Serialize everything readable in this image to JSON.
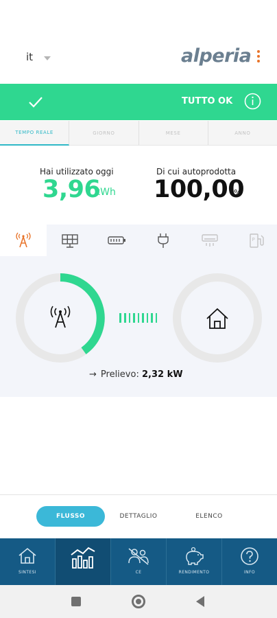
{
  "header": {
    "language": "it",
    "logo_text": "alperia"
  },
  "status": {
    "text": "TUTTO OK",
    "color": "#2fd790"
  },
  "period_tabs": [
    {
      "label": "TEMPO REALE",
      "active": true
    },
    {
      "label": "GIORNO",
      "active": false
    },
    {
      "label": "MESE",
      "active": false
    },
    {
      "label": "ANNO",
      "active": false
    }
  ],
  "stats": {
    "used_label": "Hai utilizzato oggi",
    "used_value": "3,96",
    "used_unit": "kWh",
    "self_label": "Di cui autoprodotta",
    "self_value": "100,00",
    "self_unit": "%"
  },
  "device_tabs": [
    {
      "icon": "grid-tower-icon",
      "active": true
    },
    {
      "icon": "solar-panel-icon",
      "active": false
    },
    {
      "icon": "battery-icon",
      "active": false
    },
    {
      "icon": "plug-icon",
      "active": false
    },
    {
      "icon": "air-conditioner-icon",
      "active": false
    },
    {
      "icon": "ev-charger-icon",
      "active": false
    }
  ],
  "flow": {
    "source_icon": "grid-tower-icon",
    "target_icon": "house-icon",
    "prelievo_label": "Prelievo:",
    "prelievo_value": "2,32 kW"
  },
  "view_toggle": {
    "flusso": "FLUSSO",
    "dettaglio": "DETTAGLIO",
    "elenco": "ELENCO",
    "active": "FLUSSO"
  },
  "bottom_nav": [
    {
      "label": "SINTESI",
      "icon": "home-icon",
      "active": false
    },
    {
      "label": "",
      "icon": "chart-icon",
      "active": true
    },
    {
      "label": "CE",
      "icon": "community-icon",
      "active": false
    },
    {
      "label": "RENDIMENTO",
      "icon": "piggy-bank-icon",
      "active": false
    },
    {
      "label": "INFO",
      "icon": "help-icon",
      "active": false
    }
  ],
  "colors": {
    "accent_green": "#2fd790",
    "accent_blue": "#3bb8d8",
    "nav_blue": "#155a85",
    "orange": "#e8742a"
  }
}
